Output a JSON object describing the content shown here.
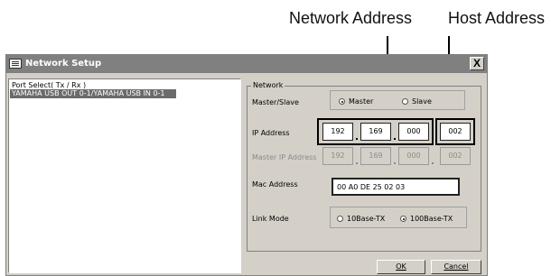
{
  "callouts": {
    "network_address": "Network Address",
    "host_address": "Host Address"
  },
  "window": {
    "title": "Network Setup",
    "icon": "network-setup-app-icon",
    "close_label": "X"
  },
  "port_list": {
    "header": "Port Select( Tx / Rx )",
    "items": [
      "YAMAHA USB OUT 0-1/YAMAHA USB IN 0-1"
    ],
    "selected_index": 0
  },
  "network": {
    "group_title": "Network",
    "master_slave": {
      "label": "Master/Slave",
      "options": [
        "Master",
        "Slave"
      ],
      "selected": "Master"
    },
    "ip_address": {
      "label": "IP Address",
      "octets": [
        "192",
        "169",
        "000",
        "002"
      ]
    },
    "master_ip_address": {
      "label": "Master IP Address",
      "octets": [
        "192",
        "169",
        "000",
        "002"
      ],
      "disabled": true
    },
    "mac_address": {
      "label": "Mac Address",
      "value": "00 A0 DE 25 02 03"
    },
    "link_mode": {
      "label": "Link Mode",
      "options": [
        "10Base-TX",
        "100Base-TX"
      ],
      "selected": "100Base-TX"
    }
  },
  "buttons": {
    "ok": "OK",
    "cancel": "Cancel"
  }
}
